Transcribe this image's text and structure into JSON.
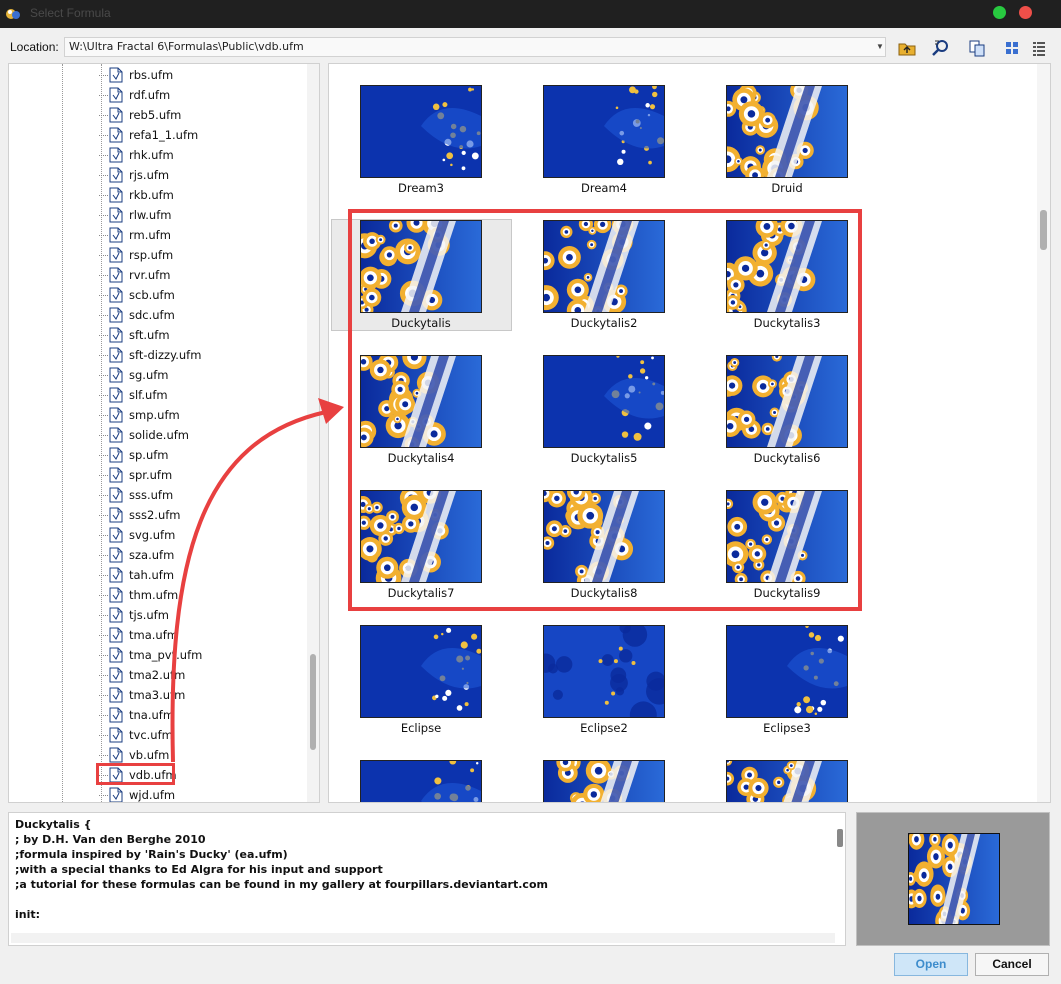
{
  "window": {
    "title": "Select Formula",
    "accent_open": "#3d8ccc",
    "annotation_color": "#e84040"
  },
  "location": {
    "label": "Location:",
    "value": "W:\\Ultra Fractal 6\\Formulas\\Public\\vdb.ufm"
  },
  "toolbar": {
    "icons": [
      "folder-up-icon",
      "search-folder-icon",
      "copy-icon",
      "large-icons-view-icon",
      "details-view-icon"
    ]
  },
  "tree": {
    "items": [
      "rbs.ufm",
      "rdf.ufm",
      "reb5.ufm",
      "refa1_1.ufm",
      "rhk.ufm",
      "rjs.ufm",
      "rkb.ufm",
      "rlw.ufm",
      "rm.ufm",
      "rsp.ufm",
      "rvr.ufm",
      "scb.ufm",
      "sdc.ufm",
      "sft.ufm",
      "sft-dizzy.ufm",
      "sg.ufm",
      "slf.ufm",
      "smp.ufm",
      "solide.ufm",
      "sp.ufm",
      "spr.ufm",
      "sss.ufm",
      "sss2.ufm",
      "svg.ufm",
      "sza.ufm",
      "tah.ufm",
      "thm.ufm",
      "tjs.ufm",
      "tma.ufm",
      "tma_pvt.ufm",
      "tma2.ufm",
      "tma3.ufm",
      "tna.ufm",
      "tvc.ufm",
      "vb.ufm",
      "vdb.ufm",
      "wjd.ufm"
    ],
    "selected": "vdb.ufm"
  },
  "gallery": {
    "items": [
      {
        "label": "Dream3",
        "style": "dark"
      },
      {
        "label": "Dream4",
        "style": "dark"
      },
      {
        "label": "Druid",
        "style": "fire"
      },
      {
        "label": "Duckytalis",
        "style": "fire"
      },
      {
        "label": "Duckytalis2",
        "style": "fire"
      },
      {
        "label": "Duckytalis3",
        "style": "fire"
      },
      {
        "label": "Duckytalis4",
        "style": "fire"
      },
      {
        "label": "Duckytalis5",
        "style": "dark"
      },
      {
        "label": "Duckytalis6",
        "style": "fire"
      },
      {
        "label": "Duckytalis7",
        "style": "fire"
      },
      {
        "label": "Duckytalis8",
        "style": "fire"
      },
      {
        "label": "Duckytalis9",
        "style": "fire"
      },
      {
        "label": "Eclipse",
        "style": "dark"
      },
      {
        "label": "Eclipse2",
        "style": "mid"
      },
      {
        "label": "Eclipse3",
        "style": "dark"
      },
      {
        "label": "",
        "style": "dark"
      },
      {
        "label": "",
        "style": "fire"
      },
      {
        "label": "",
        "style": "fire"
      }
    ],
    "selected": "Duckytalis"
  },
  "description": {
    "lines": [
      "Duckytalis {",
      "; by D.H. Van den Berghe 2010",
      ";formula inspired by 'Rain's Ducky' (ea.ufm)",
      ";with a special thanks to Ed Algra for his input and support",
      ";a tutorial for these formulas can be found in my gallery at fourpillars.deviantart.com",
      "",
      "init:"
    ]
  },
  "buttons": {
    "open": "Open",
    "cancel": "Cancel"
  }
}
